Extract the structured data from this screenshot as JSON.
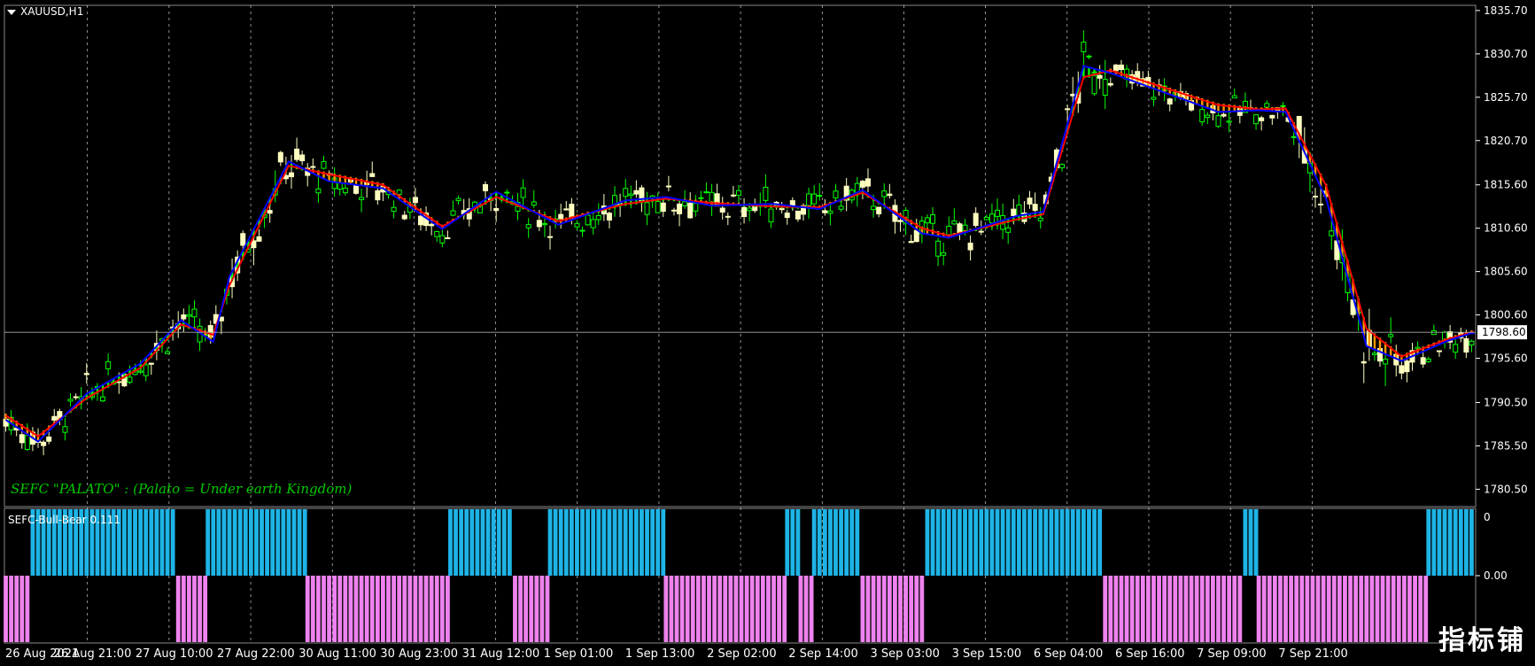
{
  "window": {
    "symbol_label": "XAUUSD,H1",
    "indicator_label": "SEFC-Bull-Bear 0.111",
    "overlay_note": "SEFC \"PALATO\" : (Palato = Under earth Kingdom)",
    "watermark": "指标铺"
  },
  "colors": {
    "background": "#000000",
    "bull_candle": "#00ff00",
    "bear_candle": "#ffffc0",
    "band_bull_fill": "#00ff00",
    "band_bear_fill": "#ff9900",
    "fast_line": "#0000ff",
    "slow_line": "#ff0000",
    "bull_histogram": "#1eb4e6",
    "bear_histogram": "#ee82ee",
    "grid": "#ffffff",
    "axis_text": "#ffffff"
  },
  "chart_data": [
    {
      "type": "candlestick",
      "title": "XAUUSD,H1",
      "price_axis_ticks": [
        "1835.70",
        "1830.70",
        "1825.70",
        "1820.70",
        "1815.60",
        "1810.60",
        "1805.60",
        "1800.60",
        "1795.60",
        "1790.50",
        "1785.50",
        "1780.50"
      ],
      "ylim": [
        1778.5,
        1836.3
      ],
      "current_price": "1798.60",
      "time_axis_labels": [
        "26 Aug 2021",
        "26 Aug 21:00",
        "27 Aug 10:00",
        "27 Aug 22:00",
        "30 Aug 11:00",
        "30 Aug 23:00",
        "31 Aug 12:00",
        "1 Sep 01:00",
        "1 Sep 13:00",
        "2 Sep 02:00",
        "2 Sep 14:00",
        "3 Sep 03:00",
        "3 Sep 15:00",
        "6 Sep 04:00",
        "6 Sep 16:00",
        "7 Sep 09:00",
        "7 Sep 21:00"
      ],
      "grid": "vertical-dotted",
      "band_points": [
        {
          "i": 0,
          "fast": 1788.5,
          "slow": 1789.0
        },
        {
          "i": 12,
          "fast": 1786.0,
          "slow": 1786.6
        },
        {
          "i": 30,
          "fast": 1791.5,
          "slow": 1791.0
        },
        {
          "i": 50,
          "fast": 1795.0,
          "slow": 1794.5
        },
        {
          "i": 65,
          "fast": 1800.0,
          "slow": 1799.5
        },
        {
          "i": 77,
          "fast": 1797.5,
          "slow": 1798.3
        },
        {
          "i": 83,
          "fast": 1805.0,
          "slow": 1804.0
        },
        {
          "i": 105,
          "fast": 1818.3,
          "slow": 1817.8
        },
        {
          "i": 120,
          "fast": 1816.0,
          "slow": 1816.8
        },
        {
          "i": 140,
          "fast": 1815.2,
          "slow": 1815.6
        },
        {
          "i": 162,
          "fast": 1810.5,
          "slow": 1810.8
        },
        {
          "i": 182,
          "fast": 1814.8,
          "slow": 1814.2
        },
        {
          "i": 205,
          "fast": 1811.0,
          "slow": 1811.4
        },
        {
          "i": 230,
          "fast": 1813.8,
          "slow": 1813.4
        },
        {
          "i": 245,
          "fast": 1814.2,
          "slow": 1814.0
        },
        {
          "i": 262,
          "fast": 1813.2,
          "slow": 1813.5
        },
        {
          "i": 285,
          "fast": 1813.4,
          "slow": 1813.1
        },
        {
          "i": 302,
          "fast": 1812.8,
          "slow": 1813.0
        },
        {
          "i": 318,
          "fast": 1815.0,
          "slow": 1814.7
        },
        {
          "i": 340,
          "fast": 1810.0,
          "slow": 1810.6
        },
        {
          "i": 350,
          "fast": 1809.5,
          "slow": 1809.7
        },
        {
          "i": 375,
          "fast": 1812.0,
          "slow": 1811.6
        },
        {
          "i": 385,
          "fast": 1812.5,
          "slow": 1812.2
        },
        {
          "i": 400,
          "fast": 1829.3,
          "slow": 1828.0
        },
        {
          "i": 410,
          "fast": 1828.5,
          "slow": 1828.8
        },
        {
          "i": 450,
          "fast": 1824.0,
          "slow": 1824.8
        },
        {
          "i": 465,
          "fast": 1824.2,
          "slow": 1824.3
        },
        {
          "i": 475,
          "fast": 1824.0,
          "slow": 1824.4
        },
        {
          "i": 490,
          "fast": 1814.0,
          "slow": 1815.5
        },
        {
          "i": 505,
          "fast": 1797.0,
          "slow": 1799.0
        },
        {
          "i": 518,
          "fast": 1795.3,
          "slow": 1795.8
        },
        {
          "i": 535,
          "fast": 1797.6,
          "slow": 1797.8
        },
        {
          "i": 544,
          "fast": 1798.5,
          "slow": 1798.6
        }
      ],
      "candle_noise": [
        {
          "from": 0,
          "to": 30,
          "amp": 1.8
        },
        {
          "from": 30,
          "to": 83,
          "amp": 2.0
        },
        {
          "from": 83,
          "to": 110,
          "amp": 2.8
        },
        {
          "from": 110,
          "to": 390,
          "amp": 1.9
        },
        {
          "from": 390,
          "to": 410,
          "amp": 3.0
        },
        {
          "from": 410,
          "to": 480,
          "amp": 1.5
        },
        {
          "from": 480,
          "to": 520,
          "amp": 3.2
        },
        {
          "from": 520,
          "to": 545,
          "amp": 1.6
        }
      ]
    },
    {
      "type": "bar",
      "title": "SEFC-Bull-Bear 0.111",
      "axis_ticks": [
        "0",
        "0.00"
      ],
      "ylim": [
        -1,
        1
      ],
      "segments": [
        {
          "from": 0,
          "to": 10,
          "value": -1
        },
        {
          "from": 10,
          "to": 64,
          "value": 1
        },
        {
          "from": 64,
          "to": 75,
          "value": -1
        },
        {
          "from": 75,
          "to": 112,
          "value": 1
        },
        {
          "from": 112,
          "to": 165,
          "value": -1
        },
        {
          "from": 165,
          "to": 189,
          "value": 1
        },
        {
          "from": 189,
          "to": 202,
          "value": -1
        },
        {
          "from": 202,
          "to": 245,
          "value": 1
        },
        {
          "from": 245,
          "to": 290,
          "value": -1
        },
        {
          "from": 290,
          "to": 295,
          "value": 1
        },
        {
          "from": 295,
          "to": 300,
          "value": -1
        },
        {
          "from": 300,
          "to": 318,
          "value": 1
        },
        {
          "from": 318,
          "to": 342,
          "value": -1
        },
        {
          "from": 342,
          "to": 408,
          "value": 1
        },
        {
          "from": 408,
          "to": 460,
          "value": -1
        },
        {
          "from": 460,
          "to": 465,
          "value": 1
        },
        {
          "from": 465,
          "to": 528,
          "value": -1
        },
        {
          "from": 528,
          "to": 545,
          "value": 1
        }
      ]
    }
  ]
}
